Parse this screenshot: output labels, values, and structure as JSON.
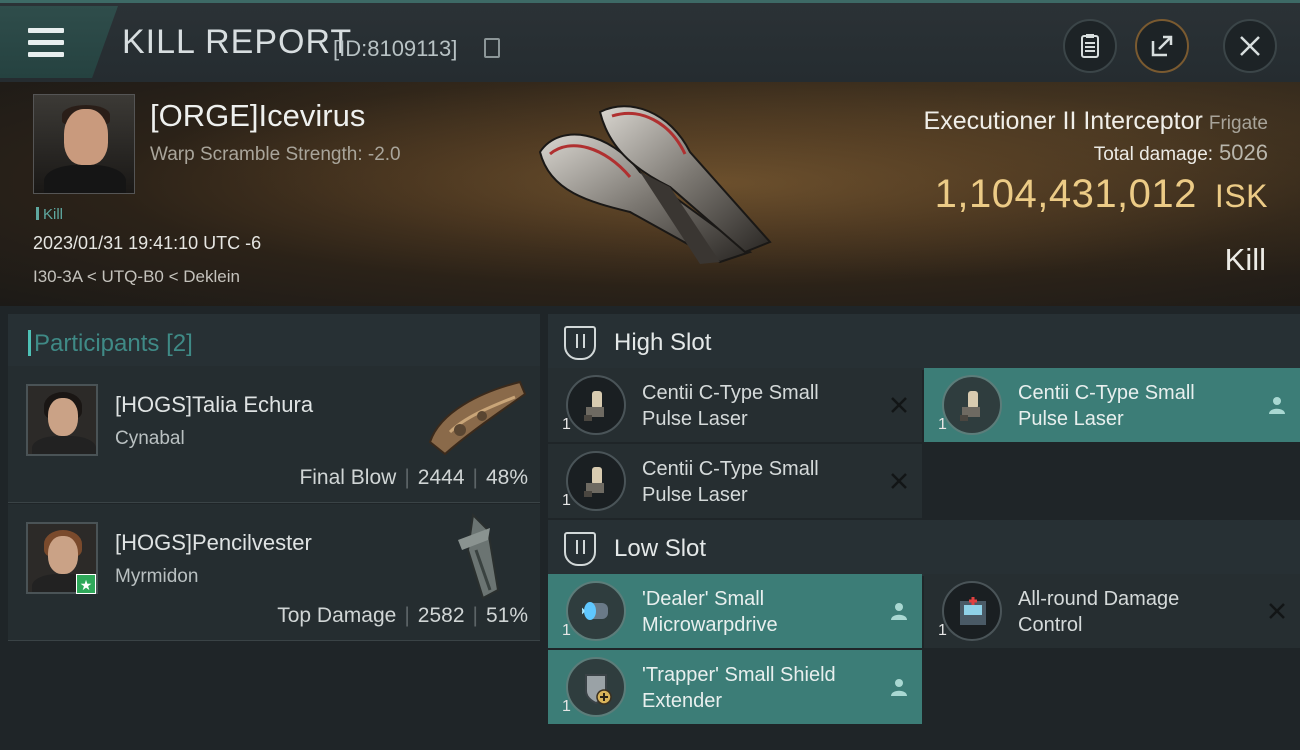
{
  "header": {
    "title": "KILL REPORT",
    "report_id": "[ID:8109113]"
  },
  "victim": {
    "name": "[ORGE]Icevirus",
    "warp_scramble": "Warp Scramble Strength: -2.0",
    "tag": "Kill",
    "datetime": "2023/01/31 19:41:10 UTC -6",
    "location": "I30-3A < UTQ-B0 < Deklein",
    "ship": "Executioner II Interceptor",
    "ship_class": "Frigate",
    "total_damage_label": "Total damage:",
    "total_damage": "5026",
    "isk_value": "1,104,431,012",
    "isk_unit": "ISK",
    "outcome": "Kill"
  },
  "participants": {
    "label": "Participants",
    "count": "[2]",
    "items": [
      {
        "name": "[HOGS]Talia Echura",
        "ship": "Cynabal",
        "role": "Final Blow",
        "damage": "2444",
        "percent": "48%"
      },
      {
        "name": "[HOGS]Pencilvester",
        "ship": "Myrmidon",
        "role": "Top Damage",
        "damage": "2582",
        "percent": "51%"
      }
    ]
  },
  "fitting": {
    "high_slot_label": "High Slot",
    "low_slot_label": "Low Slot",
    "high": [
      {
        "line1": "Centii C-Type Small",
        "line2": "Pulse Laser",
        "qty": "1",
        "status": "destroyed"
      },
      {
        "line1": "Centii C-Type Small",
        "line2": "Pulse Laser",
        "qty": "1",
        "status": "dropped"
      },
      {
        "line1": "Centii C-Type Small",
        "line2": "Pulse Laser",
        "qty": "1",
        "status": "destroyed"
      }
    ],
    "low": [
      {
        "line1": "'Dealer' Small",
        "line2": "Microwarpdrive",
        "qty": "1",
        "status": "dropped"
      },
      {
        "line1": "All-round Damage",
        "line2": "Control",
        "qty": "1",
        "status": "destroyed"
      },
      {
        "line1": "'Trapper' Small Shield",
        "line2": "Extender",
        "qty": "1",
        "status": "dropped"
      }
    ]
  },
  "colors": {
    "accent": "#4ec2b7",
    "isk": "#eccb86",
    "dropped_bg": "#3c7d77"
  }
}
